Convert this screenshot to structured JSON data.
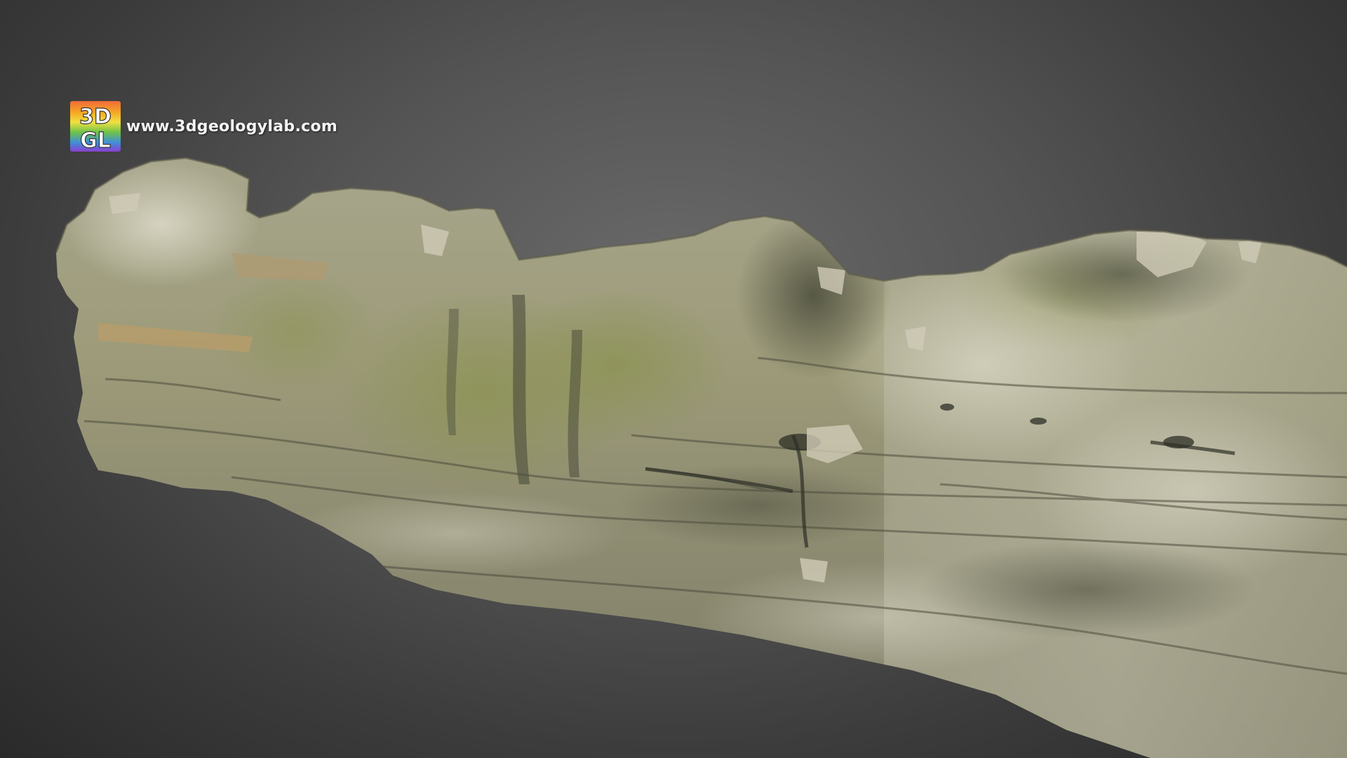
{
  "viewer": {
    "scene": "textured 3D rock outcrop model",
    "background_colors": [
      "#6a6a6a",
      "#3a3a3a"
    ]
  },
  "watermark": {
    "logo_line1": "3D",
    "logo_line2": "GL",
    "url": "www.3dgeologylab.com",
    "logo_colors": [
      "#e94b3c",
      "#f5a623",
      "#f8e71c",
      "#7ed321",
      "#4a90e2",
      "#9013fe"
    ]
  },
  "model": {
    "colors": {
      "base": "#9a9a80",
      "light": "#c9c7b0",
      "shadow": "#5a5a48",
      "moss": "#8a8f55",
      "dark_streak": "#3f4234",
      "ochre": "#b09a70"
    }
  }
}
